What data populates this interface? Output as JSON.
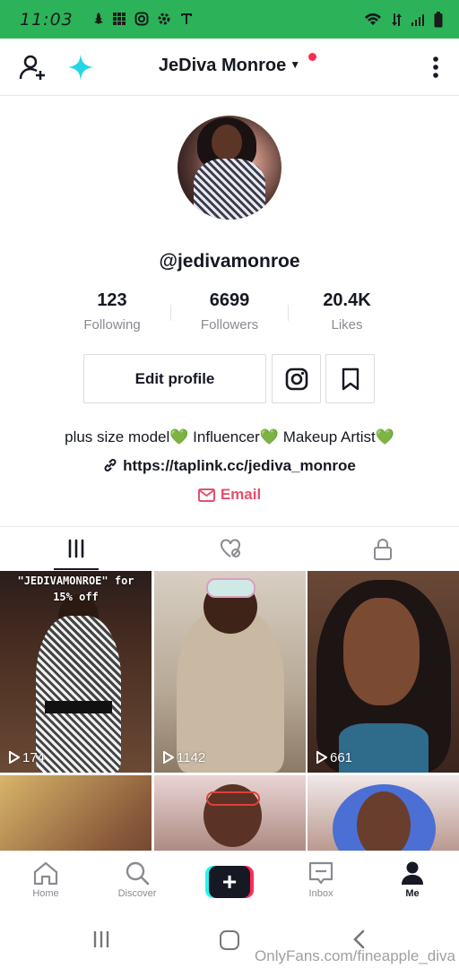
{
  "status_bar": {
    "time": "11:03"
  },
  "header": {
    "title": "JeDiva Monroe"
  },
  "profile": {
    "username": "@jedivamonroe"
  },
  "stats": [
    {
      "value": "123",
      "label": "Following"
    },
    {
      "value": "6699",
      "label": "Followers"
    },
    {
      "value": "20.4K",
      "label": "Likes"
    }
  ],
  "actions": {
    "edit_profile": "Edit profile"
  },
  "bio": {
    "text": "plus size model💚 Influencer💚 Makeup Artist💚",
    "link": "https://taplink.cc/jediva_monroe",
    "email": "Email"
  },
  "videos": [
    {
      "views": "174",
      "caption_line1": "\"JEDIVAMONROE\" for",
      "caption_line2": "15% off"
    },
    {
      "views": "1142"
    },
    {
      "views": "661"
    },
    {
      "views": ""
    },
    {
      "views": ""
    },
    {
      "views": ""
    }
  ],
  "bottom_nav": {
    "home": "Home",
    "discover": "Discover",
    "create": "+",
    "inbox": "Inbox",
    "me": "Me"
  },
  "watermark": "OnlyFans.com/fineapple_diva",
  "colors": {
    "status_bar": "#2cb35a",
    "accent_red": "#fe2c55",
    "accent_cyan": "#25f4ee",
    "email_pink": "#e4506e",
    "heart_green": "#3fcb24"
  }
}
